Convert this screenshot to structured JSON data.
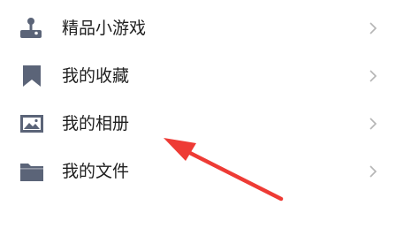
{
  "menu": {
    "items": [
      {
        "label": "精品小游戏",
        "icon": "joystick-icon"
      },
      {
        "label": "我的收藏",
        "icon": "bookmark-icon"
      },
      {
        "label": "我的相册",
        "icon": "photo-album-icon"
      },
      {
        "label": "我的文件",
        "icon": "folder-icon"
      }
    ]
  },
  "colors": {
    "icon": "#5b6478",
    "text": "#1f1f1f",
    "chevron": "#b5b5b5",
    "annotation_arrow": "#ee3b35"
  }
}
